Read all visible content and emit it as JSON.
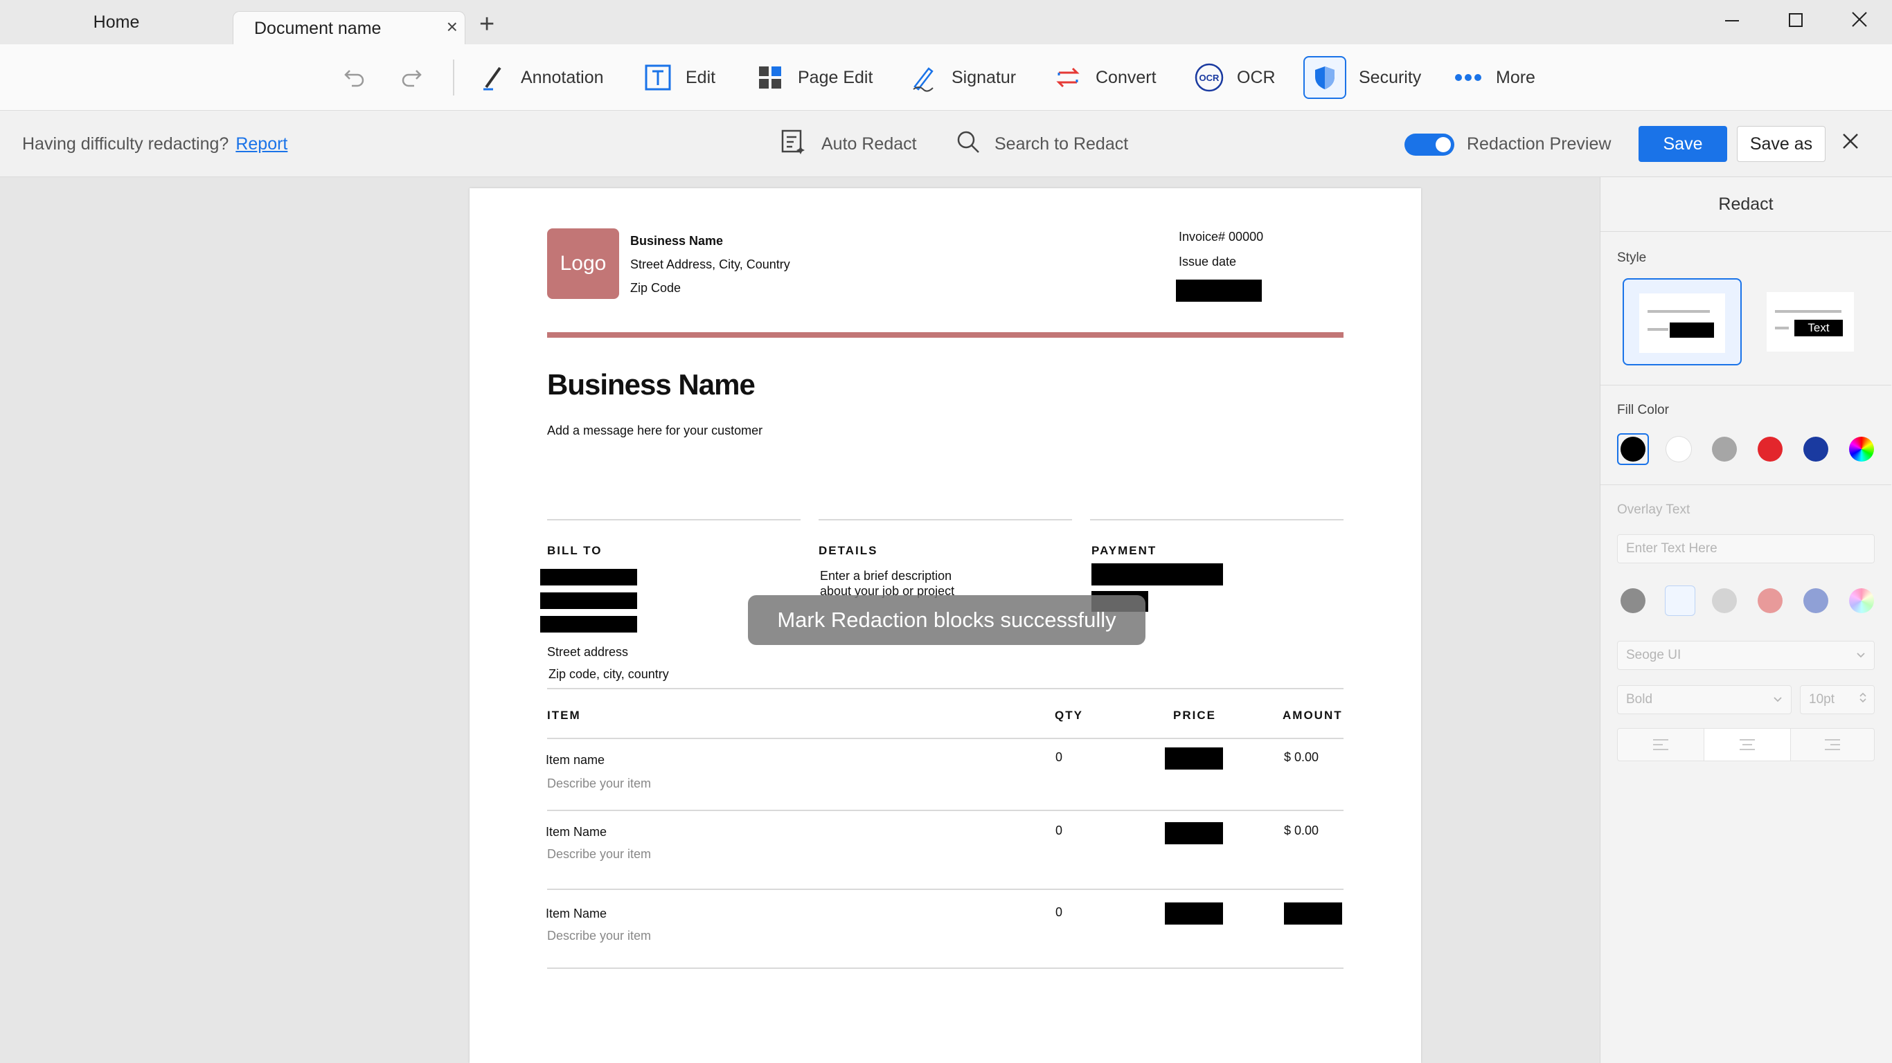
{
  "titlebar": {
    "tabs": [
      {
        "label": "Home"
      },
      {
        "label": "Document name"
      }
    ],
    "new_tab_icon": "+",
    "close_tab_icon": "×"
  },
  "toolbar": {
    "items": [
      {
        "label": "Annotation",
        "icon": "pen-icon"
      },
      {
        "label": "Edit",
        "icon": "text-edit-icon"
      },
      {
        "label": "Page Edit",
        "icon": "grid-icon"
      },
      {
        "label": "Signatur",
        "icon": "signature-icon"
      },
      {
        "label": "Convert",
        "icon": "convert-icon"
      },
      {
        "label": "OCR",
        "icon": "ocr-icon"
      },
      {
        "label": "Security",
        "icon": "shield-icon"
      },
      {
        "label": "More",
        "icon": "more-dots-icon"
      }
    ],
    "accent": "#1a73e8"
  },
  "redactbar": {
    "difficulty_text": "Having difficulty redacting?",
    "report_link": "Report",
    "auto_redact": "Auto Redact",
    "search_redact": "Search to Redact",
    "preview_label": "Redaction Preview",
    "preview_on": true,
    "save": "Save",
    "save_as": "Save as"
  },
  "document": {
    "logo": "Logo",
    "logo_color": "#c27676",
    "business_name_small": "Business Name",
    "street": "Street Address, City, Country",
    "zip": "Zip Code",
    "invoice_no": "Invoice# 00000",
    "issue_date": "Issue date",
    "title": "Business Name",
    "message": "Add a message here for your customer",
    "bill_to": "BILL TO",
    "details": "DETAILS",
    "payment": "PAYMENT",
    "details_text_1": "Enter a brief description",
    "details_text_2": "about your job or project",
    "street_address": "Street address",
    "zip_city": "Zip code, city, country",
    "col_item": "ITEM",
    "col_qty": "QTY",
    "col_price": "PRICE",
    "col_amount": "AMOUNT",
    "rows": [
      {
        "name": "Item name",
        "desc": "Describe your item",
        "qty": "0",
        "amount": "$ 0.00"
      },
      {
        "name": "Item Name",
        "desc": "Describe your item",
        "qty": "0",
        "amount": "$ 0.00"
      },
      {
        "name": "Item Name",
        "desc": "Describe your item",
        "qty": "0",
        "amount": ""
      }
    ]
  },
  "toast": "Mark Redaction blocks successfully",
  "panel": {
    "title": "Redact",
    "style_label": "Style",
    "style_text_sample": "Text",
    "fill_color_label": "Fill Color",
    "fill_colors": [
      "#000000",
      "#ffffff",
      "#a6a6a6",
      "#e3262c",
      "#1a3aa0",
      "rainbow"
    ],
    "overlay_text_label": "Overlay Text",
    "overlay_placeholder": "Enter Text Here",
    "overlay_colors": [
      "#8c8c8c",
      "#f0f6ff",
      "#d4d4d4",
      "#e89a9a",
      "#8fa0d6",
      "rainbow"
    ],
    "font_name": "Seoge UI",
    "font_weight": "Bold",
    "font_size": "10pt"
  }
}
